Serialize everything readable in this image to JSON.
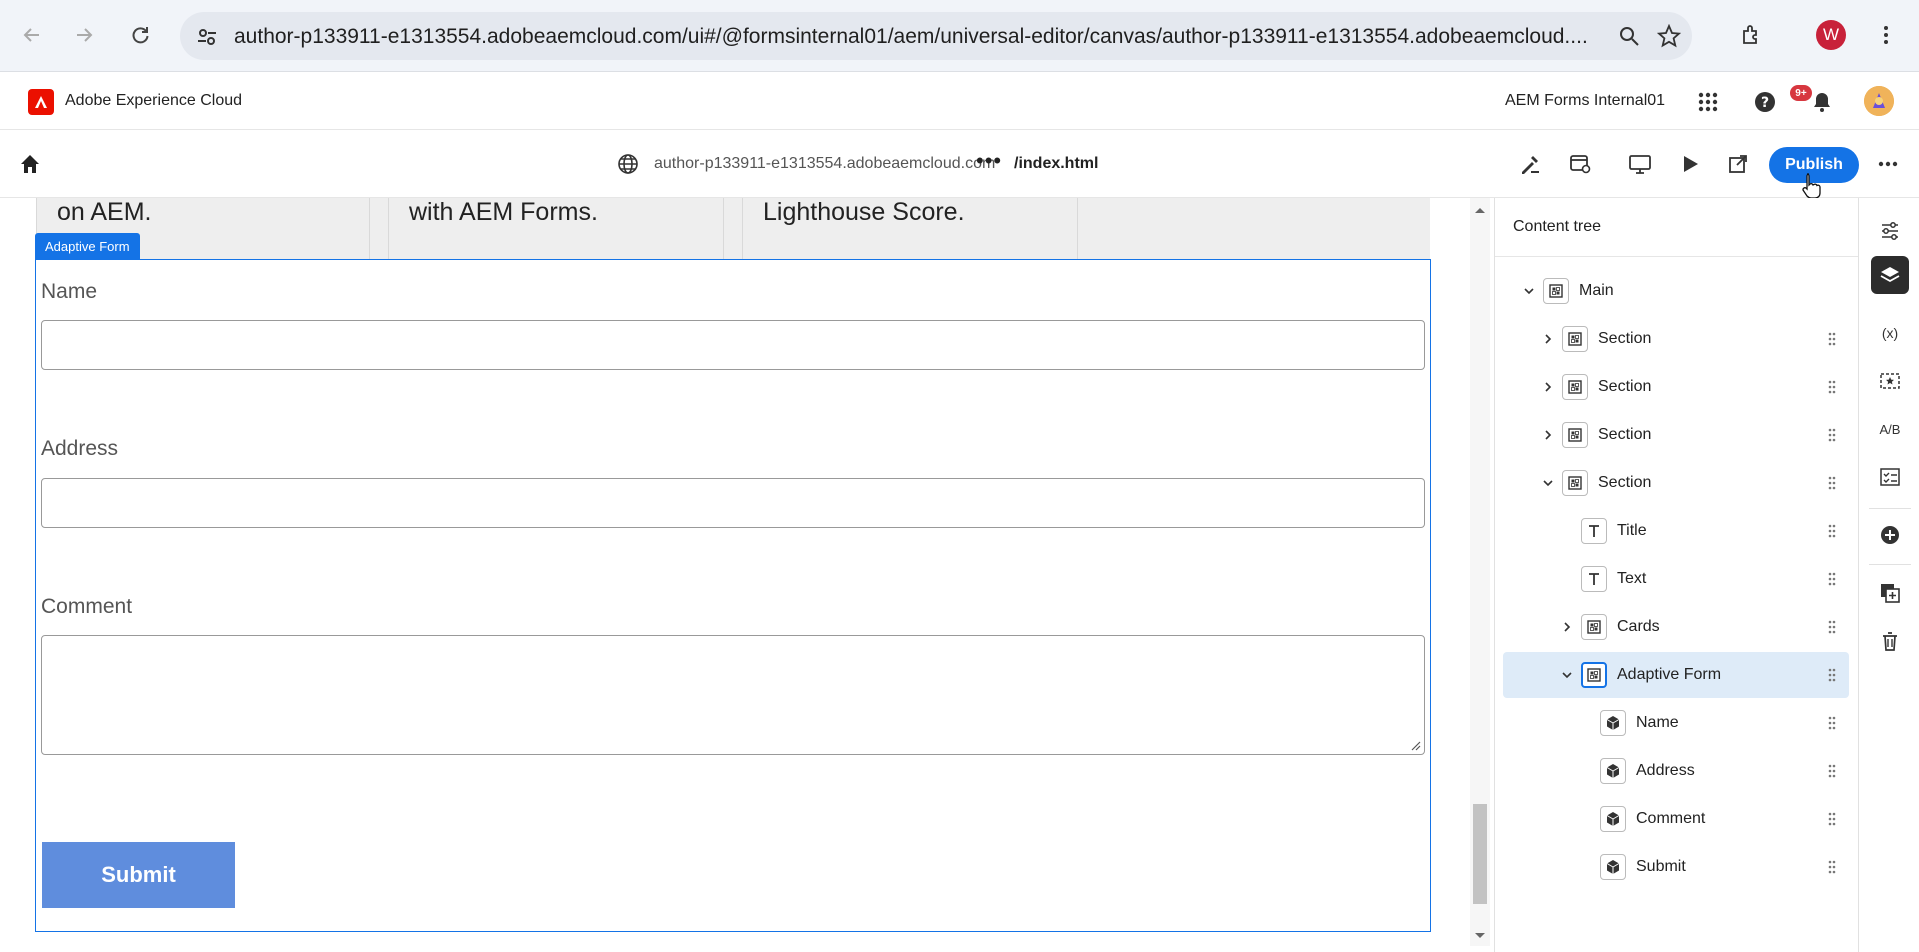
{
  "browser": {
    "url": "author-p133911-e1313554.adobeaemcloud.com/ui#/@formsinternal01/aem/universal-editor/canvas/author-p133911-e1313554.adobeaemcloud....",
    "profile_initial": "W"
  },
  "shell": {
    "brand": "Adobe Experience Cloud",
    "org": "AEM Forms Internal01",
    "notification_count": "9+"
  },
  "toolbar": {
    "host": "author-p133911-e1313554.adobeaemcloud.com",
    "more": "•••",
    "path": "/index.html",
    "publish_label": "Publish",
    "overflow": "•••"
  },
  "canvas": {
    "cards": [
      "on AEM.",
      "with AEM Forms.",
      "Lighthouse Score."
    ],
    "form_tag": "Adaptive Form",
    "fields": {
      "name_label": "Name",
      "address_label": "Address",
      "comment_label": "Comment"
    },
    "submit_label": "Submit"
  },
  "panel": {
    "title": "Content tree",
    "tree": [
      {
        "label": "Main",
        "icon": "block-icon",
        "chevron": "down"
      },
      {
        "label": "Section",
        "icon": "block-icon",
        "chevron": "right"
      },
      {
        "label": "Section",
        "icon": "block-icon",
        "chevron": "right"
      },
      {
        "label": "Section",
        "icon": "block-icon",
        "chevron": "right"
      },
      {
        "label": "Section",
        "icon": "block-icon",
        "chevron": "down"
      },
      {
        "label": "Title",
        "icon": "text-icon",
        "chevron": "none"
      },
      {
        "label": "Text",
        "icon": "text-icon",
        "chevron": "none"
      },
      {
        "label": "Cards",
        "icon": "block-icon",
        "chevron": "right"
      },
      {
        "label": "Adaptive Form",
        "icon": "block-icon",
        "chevron": "down"
      },
      {
        "label": "Name",
        "icon": "component-icon",
        "chevron": "none"
      },
      {
        "label": "Address",
        "icon": "component-icon",
        "chevron": "none"
      },
      {
        "label": "Comment",
        "icon": "component-icon",
        "chevron": "none"
      },
      {
        "label": "Submit",
        "icon": "component-icon",
        "chevron": "none"
      }
    ]
  },
  "rail": {
    "variables_label": "(x)",
    "ab_label": "A/B"
  },
  "colors": {
    "accent": "#1473e6",
    "selected_row": "#deebf8",
    "submit_button": "#5f8ddd",
    "adobe_red": "#eb1000"
  }
}
